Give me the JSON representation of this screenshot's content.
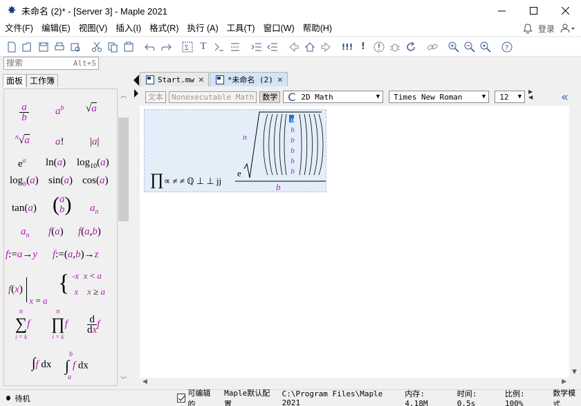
{
  "window": {
    "title": "未命名 (2)* - [Server 3] - Maple 2021",
    "min_icon": "minimize-icon",
    "max_icon": "maximize-icon",
    "close_icon": "close-icon"
  },
  "menu": {
    "items": [
      "文件(F)",
      "编辑(E)",
      "视图(V)",
      "插入(I)",
      "格式(R)",
      "执行 (A)",
      "工具(T)",
      "窗口(W)",
      "帮助(H)"
    ],
    "login": "登录"
  },
  "toolbar": {
    "icons": [
      "new-document-icon",
      "open-icon",
      "save-icon",
      "print-icon",
      "print-preview-icon",
      "cut-icon",
      "copy-icon",
      "paste-icon",
      "undo-icon",
      "redo-icon",
      "math-mode-icon",
      "text-mode-icon",
      "execution-group-icon",
      "paragraph-icon",
      "indent-icon",
      "outdent-icon",
      "back-icon",
      "home-icon",
      "forward-icon",
      "execute-icon",
      "execute-all-icon",
      "stop-icon",
      "debug-icon",
      "restart-icon",
      "link-icon",
      "zoom-in-icon",
      "zoom-out-icon",
      "zoom-reset-icon",
      "help-icon"
    ],
    "text_icon_glyph": "T",
    "bang_glyph": "!!!",
    "bang_single_glyph": "!"
  },
  "search": {
    "placeholder": "搜索",
    "shortcut": "Alt+S"
  },
  "panel": {
    "tabs": [
      "面板",
      "工作簿"
    ],
    "palette": {
      "a": "a",
      "b": "b",
      "n": "n",
      "k": "k",
      "x": "x",
      "y": "y",
      "z": "z",
      "f": "f",
      "i": "i",
      "d": "d",
      "e": "e",
      "ln": "ln",
      "log": "log",
      "sin": "sin",
      "cos": "cos",
      "tan": "tan",
      "log10_sub": "10",
      "eq_assign": ":=",
      "arrow": "→",
      "fact": "!",
      "neg_x": "-x",
      "lt": "<",
      "ge": "≥",
      "eq": "=",
      "sigma": "∑",
      "prod": "∏",
      "int": "∫",
      "i_eq_k": "i = k",
      "paren_open": "(",
      "paren_close": ")",
      "comma": ",",
      "pipe": "|",
      "sqrt": "√",
      "dx": "dx"
    }
  },
  "doc_tabs": [
    {
      "label": "Start.mw",
      "active": false
    },
    {
      "label": "*未命名 (2)",
      "active": true
    }
  ],
  "context_bar": {
    "btn_text": "文本",
    "btn_nonexec": "Nonexecutable Math",
    "btn_math": "数学",
    "mode_select": "2D Math",
    "font_select": "Times New Roman",
    "size_select": "12",
    "collapse": "«"
  },
  "document": {
    "prod_symbol": "∏",
    "expr": "∝ ≠ ≠ ℚ ⊥ ⊥ jj",
    "root_index": "n",
    "exponent_base": "e",
    "denominator": "b",
    "column_values": [
      "a",
      "b",
      "b",
      "b",
      "b",
      "b"
    ]
  },
  "status": {
    "state": "待机",
    "editable": "可编辑的",
    "config": "Maple默认配置",
    "path": "C:\\Program Files\\Maple 2021",
    "memory": "内存: 4.18M",
    "time": "时间: 0.5s",
    "zoom": "比例: 100%",
    "mode": "数学模式"
  }
}
